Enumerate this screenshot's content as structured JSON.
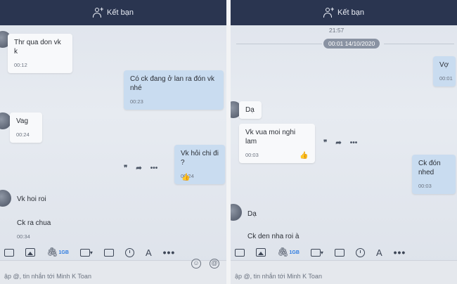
{
  "header": {
    "add_friend_label": "Kết bạn"
  },
  "left": {
    "messages": [
      {
        "text": "Thr qua don vk k",
        "time": "00:12",
        "side": "other"
      },
      {
        "text": "Có ck đang ở lan ra đón vk nhé",
        "time": "00:23",
        "side": "me"
      },
      {
        "text": "Vag",
        "time": "00:24",
        "side": "other"
      },
      {
        "text": "Vk hỏi chi đi ?",
        "time": "00:24",
        "side": "me"
      },
      {
        "text": "Vk hoi roi",
        "side": "other"
      },
      {
        "text": "Ck ra chua",
        "time": "00:34",
        "side": "other"
      }
    ],
    "toolbar": {
      "file_size": "1GB"
    },
    "input_placeholder": "ập @, tin nhắn tới Minh K Toan"
  },
  "right": {
    "time_label": "21:57",
    "date_pill": "00:01 14/10/2020",
    "messages": [
      {
        "text": "Vợ",
        "time": "00:01",
        "side": "me"
      },
      {
        "text": "Dạ",
        "side": "other"
      },
      {
        "text": "Vk vua moi nghi lam",
        "time": "00:03",
        "side": "other"
      },
      {
        "text": "Ck đón nhed",
        "time": "00:03",
        "side": "me"
      },
      {
        "text": "Dạ",
        "side": "other"
      },
      {
        "text": "Ck den nha roi à",
        "side": "other"
      }
    ],
    "toolbar": {
      "file_size": "1GB"
    },
    "input_placeholder": "ập @, tin nhắn tới Minh K Toan"
  },
  "actions": {
    "quote": "❞",
    "forward": "➦",
    "more": "•••",
    "like": "👍"
  },
  "colors": {
    "header_bg": "#2a3550",
    "my_bubble": "#c9dcf0",
    "other_bubble": "#f8f9fb"
  }
}
